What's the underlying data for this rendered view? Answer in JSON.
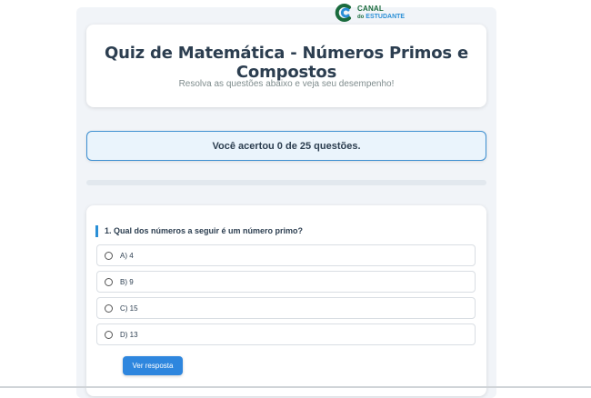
{
  "logo": {
    "line1": "CANAL",
    "line2_prefix": "do",
    "line2": "ESTUDANTE"
  },
  "header": {
    "title": "Quiz de Matemática - Números Primos e Compostos",
    "subtitle": "Resolva as questões abaixo e veja seu desempenho!"
  },
  "score": {
    "text": "Você acertou 0 de 25 questões."
  },
  "progress": {
    "value": 0
  },
  "question": {
    "title": "1. Qual dos números a seguir é um número primo?",
    "options": [
      {
        "label": "A) 4"
      },
      {
        "label": "B) 9"
      },
      {
        "label": "C) 15"
      },
      {
        "label": "D) 13"
      }
    ],
    "button_label": "Ver resposta"
  },
  "colors": {
    "accent": "#2e86de",
    "logo_green": "#1a6b3d",
    "logo_blue": "#2a8fd6"
  }
}
